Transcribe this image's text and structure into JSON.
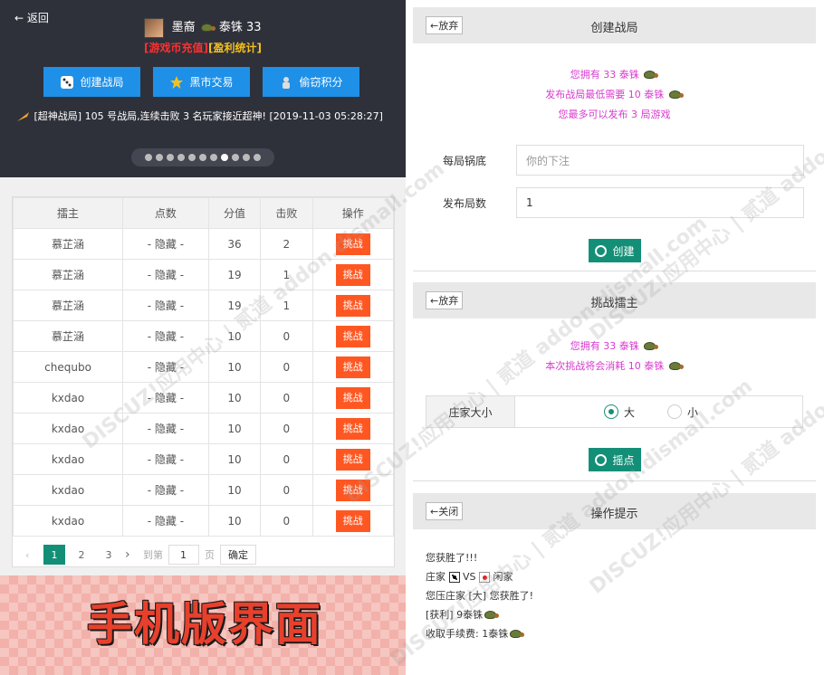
{
  "header": {
    "back_label": "返回",
    "user_name": "墨裔",
    "points_text": "泰铢 33",
    "link_recharge": "[游戏币充值]",
    "link_stats": "[盈利统计]",
    "buttons": [
      "创建战局",
      "黑市交易",
      "偷窃积分"
    ],
    "news": "[超神战局] 105 号战局,连续击败 3 名玩家接近超神! [2019-11-03 05:28:27]",
    "dots_total": 11,
    "dots_active_index": 7
  },
  "table": {
    "headers": [
      "擂主",
      "点数",
      "分值",
      "击败",
      "操作"
    ],
    "rows": [
      [
        "慕芷涵",
        "- 隐藏 -",
        "36",
        "2",
        "挑战"
      ],
      [
        "慕芷涵",
        "- 隐藏 -",
        "19",
        "1",
        "挑战"
      ],
      [
        "慕芷涵",
        "- 隐藏 -",
        "19",
        "1",
        "挑战"
      ],
      [
        "慕芷涵",
        "- 隐藏 -",
        "10",
        "0",
        "挑战"
      ],
      [
        "chequbo",
        "- 隐藏 -",
        "10",
        "0",
        "挑战"
      ],
      [
        "kxdao",
        "- 隐藏 -",
        "10",
        "0",
        "挑战"
      ],
      [
        "kxdao",
        "- 隐藏 -",
        "10",
        "0",
        "挑战"
      ],
      [
        "kxdao",
        "- 隐藏 -",
        "10",
        "0",
        "挑战"
      ],
      [
        "kxdao",
        "- 隐藏 -",
        "10",
        "0",
        "挑战"
      ],
      [
        "kxdao",
        "- 隐藏 -",
        "10",
        "0",
        "挑战"
      ]
    ]
  },
  "pager": {
    "prev": "‹",
    "pages": [
      "1",
      "2",
      "3"
    ],
    "next": "›",
    "goto_label": "到第",
    "goto_value": "1",
    "page_unit": "页",
    "confirm": "确定"
  },
  "banner": "手机版界面",
  "create_panel": {
    "back": "←放弃",
    "title": "创建战局",
    "msg1": "您拥有 33 泰铢",
    "msg2": "发布战局最低需要 10 泰铢",
    "msg3": "您最多可以发布 3 局游戏",
    "label_stake": "每局锅底",
    "placeholder_stake": "你的下注",
    "label_count": "发布局数",
    "value_count": "1",
    "submit": "创建"
  },
  "challenge_panel": {
    "back": "←放弃",
    "title": "挑战擂主",
    "msg1": "您拥有 33 泰铢",
    "msg2": "本次挑战将会消耗 10 泰铢",
    "label_size": "庄家大小",
    "opt_big": "大",
    "opt_small": "小",
    "submit": "摇点"
  },
  "tips_panel": {
    "back": "←关闭",
    "title": "操作提示",
    "line1": "您获胜了!!!",
    "line2_a": "庄家",
    "line2_vs": "VS",
    "line2_b": "闲家",
    "line3": "您压庄家 [大] 您获胜了!",
    "line4": "[获利] 9泰铢",
    "line5": "收取手续费: 1泰铢"
  },
  "watermark": "DISCUZ!应用中心 | 贰道 addon.dismall.com"
}
